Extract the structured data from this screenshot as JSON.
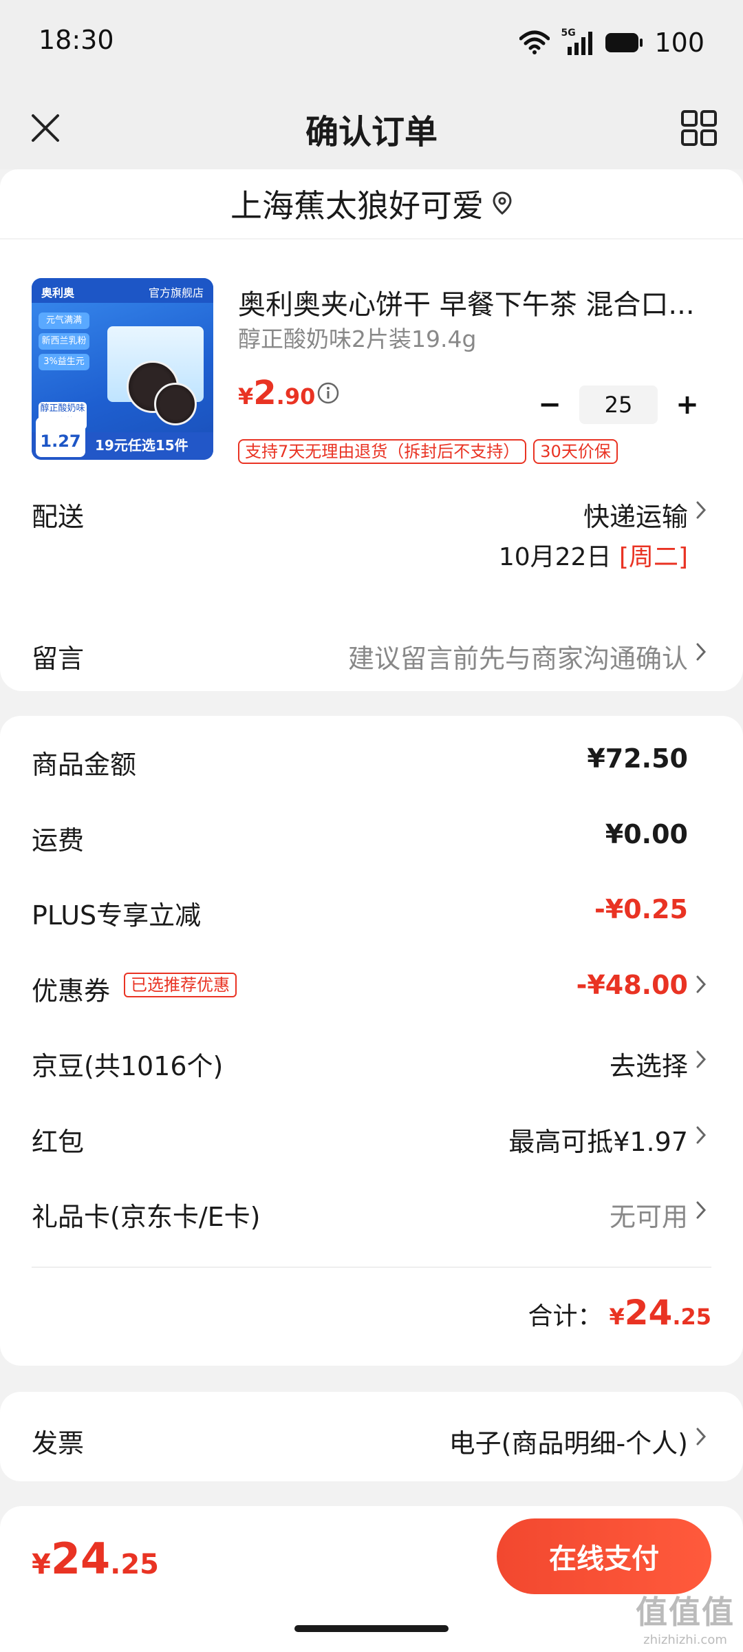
{
  "status_bar": {
    "time": "18:30",
    "network": "5G",
    "battery": "100"
  },
  "header": {
    "title": "确认订单",
    "close_icon": "close-icon",
    "menu_icon": "grid-icon"
  },
  "address": {
    "text": "上海蕉太狼好可爱",
    "icon": "location-pin-icon"
  },
  "product": {
    "image_text": {
      "brand": "奥利奥",
      "store": "官方旗舰店",
      "chips": [
        "元气满满",
        "新西兰乳粉",
        "3%益生元"
      ],
      "badge": "醇正酸奶味 2片装",
      "unit_price": "1.27",
      "promo": "19元任选15件"
    },
    "title": "奥利奥夹心饼干 早餐下午茶 混合口...",
    "variant": "醇正酸奶味2片装19.4g",
    "price": {
      "yen": "¥",
      "int": "2",
      "dec": ".90"
    },
    "quantity": "25",
    "tags": [
      "支持7天无理由退货（拆封后不支持）",
      "30天价保"
    ]
  },
  "delivery": {
    "label": "配送",
    "method": "快递运输",
    "date": "10月22日",
    "weekday": "[周二]"
  },
  "message": {
    "label": "留言",
    "placeholder": "建议留言前先与商家沟通确认"
  },
  "fees": {
    "goods_label": "商品金额",
    "goods_value": "¥72.50",
    "shipping_label": "运费",
    "shipping_value": "¥0.00",
    "plus_label": "PLUS专享立减",
    "plus_value": "-¥0.25",
    "coupon_label": "优惠券",
    "coupon_badge": "已选推荐优惠",
    "coupon_value": "-¥48.00",
    "jingdou_label": "京豆(共1016个)",
    "jingdou_value": "去选择",
    "redpacket_label": "红包",
    "redpacket_value": "最高可抵¥1.97",
    "giftcard_label": "礼品卡(京东卡/E卡)",
    "giftcard_value": "无可用",
    "total_label": "合计：",
    "total_yen": "¥",
    "total_int": "24",
    "total_dec": ".25"
  },
  "invoice": {
    "label": "发票",
    "value": "电子(商品明细-个人)"
  },
  "bottom": {
    "yen": "¥",
    "int": "24",
    "dec": ".25",
    "pay_label": "在线支付"
  },
  "watermark": {
    "logo": "值值值",
    "text": "zhizhizhi.com"
  },
  "colors": {
    "accent": "#e93323",
    "background": "#f2f2f2"
  }
}
